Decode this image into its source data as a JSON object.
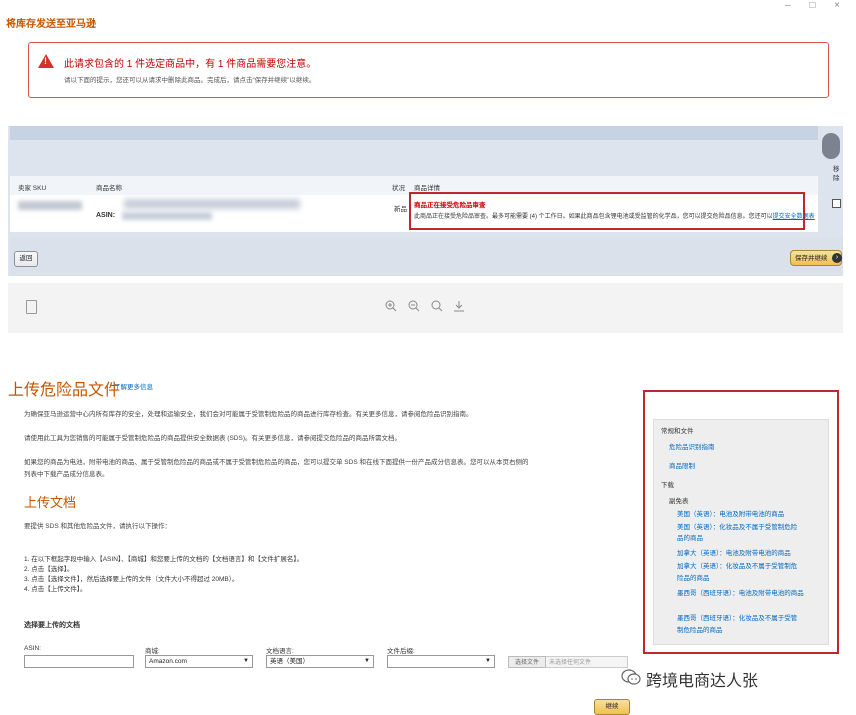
{
  "window": {
    "controls": "–  □  ×"
  },
  "page_title": "将库存发送至亚马逊",
  "alert": {
    "title": "此请求包含的 1 件选定商品中，有 1 件商品需要您注意。",
    "subtitle": "请以下面的提示，您还可以从请求中删除此商品。完成后，请点击“保存并继续”以继续。"
  },
  "table": {
    "headers": [
      "卖家 SKU",
      "商品名称",
      "状况",
      "商品详情"
    ],
    "row": {
      "asin_label": "ASIN:",
      "condition": "新品",
      "detail_title": "商品正在接受危险品审查",
      "detail_text": "此商品正在接受危险品审查。最多可能需要 (4) 个工作日。如果此商品包含锂电池或受监管的化学品，您可以提交危险品信息。您还可以",
      "detail_link": "提交安全数据表"
    },
    "side_column": "移除"
  },
  "buttons": {
    "back": "返回",
    "save_continue": "保存并继续",
    "continue": "继续"
  },
  "toolbar": {
    "icons": [
      "zoom-in-icon",
      "zoom-out-icon",
      "search-icon",
      "download-icon"
    ]
  },
  "doc": {
    "heading": "上传危险品文件",
    "learn_more": "了解更多信息",
    "para1": "为确保亚马逊运营中心内所有库存的安全，处理和运输安全，我们会对可能属于受管制危险品的商品进行库存检查。有关更多信息，请参阅危险品识别指南。",
    "para2": "请使用此工具为您销售的可能属于受管制危险品的商品提供安全数据表 (SDS)。有关更多信息，请参阅提交危险品的商品所需文档。",
    "para3a": "如果您的商品为电池，附带电池的商品、属于受管制危险品的商品或不属于受管制危险品的商品，您可以提交单 SDS 和在线下面提供一份产品成分信息表。您可以从本页右侧的",
    "para3b": "列表中下载产品成分信息表。",
    "subheading": "上传文档",
    "intro": "要提供 SDS 和其他危险品文件，请执行以下操作：",
    "steps": [
      "1. 在以下框起字段中输入【ASIN】、【商城】和您要上传的文档的【文档语言】和【文件扩展名】。",
      "2. 点击【选择】。",
      "3. 点击【选择文件】，然后选择要上传的文件（文件大小不得超过 20MB）。",
      "4. 点击【上传文件】。"
    ],
    "select_title": "选择要上传的文档",
    "fields": {
      "asin_label": "ASIN:",
      "asin_value": "",
      "market_label": "商城:",
      "market_value": "Amazon.com",
      "language_label": "文档语言:",
      "language_value": "英语（美国）",
      "ext_label": "文件后缀:",
      "ext_value": ""
    },
    "choose_file": "选择文件",
    "no_file": "未选择任何文件"
  },
  "side_panel": {
    "section1": "常规和文件",
    "link1": "危险品识别指南",
    "link2": "商品限制",
    "section2": "下载",
    "sub": "副免表",
    "items": [
      "美国（英语）：电池及附带电池的商品",
      "美国（英语）：化妆品及不属于受管制危险",
      "品的商品",
      "加拿大（英语）：电池及附带电池的商品",
      "加拿大（英语）：化妆品及不属于受管制危",
      "险品的商品",
      "墨西哥（西班牙语）：电池及附带电池的商品",
      "墨西哥（西班牙语）：化妆品及不属于受管",
      "制危险品的商品"
    ]
  },
  "watermark": "跨境电商达人张"
}
